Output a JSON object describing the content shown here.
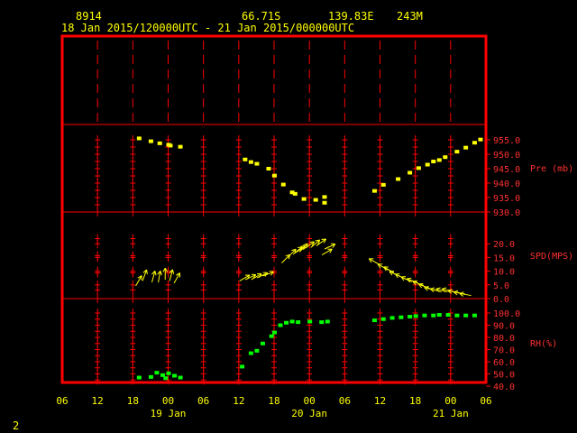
{
  "header": {
    "station_id": "8914",
    "lat": "66.71S",
    "lon": "139.83E",
    "elev": "243M",
    "period": "18 Jan 2015/120000UTC - 21 Jan 2015/000000UTC"
  },
  "footer": {
    "page_number": "2"
  },
  "colors": {
    "frame": "#ff0000",
    "pressure": "#ffff00",
    "wind": "#ffff00",
    "rh": "#00ff00",
    "axis_text": "#ffff00"
  },
  "chart_data": {
    "type": "scatter",
    "x_axis": {
      "unit": "hours since 18 Jan 2015 06UTC",
      "range": [
        0,
        72
      ],
      "tick_hours": [
        0,
        6,
        12,
        18,
        24,
        30,
        36,
        42,
        48,
        54,
        60,
        66,
        72
      ],
      "tick_labels": [
        "06",
        "12",
        "18",
        "00",
        "06",
        "12",
        "18",
        "00",
        "06",
        "12",
        "18",
        "00",
        "06"
      ],
      "day_labels": [
        {
          "hour": 18,
          "label": "19 Jan"
        },
        {
          "hour": 42,
          "label": "20 Jan"
        },
        {
          "hour": 66,
          "label": "21 Jan"
        }
      ]
    },
    "panels": [
      {
        "name": "pressure",
        "label": "Pre (mb)",
        "ylim": [
          930,
          955
        ],
        "ticks": [
          "955.0",
          "950.0",
          "945.0",
          "940.0",
          "935.0",
          "930.0"
        ],
        "tick_values": [
          955,
          950,
          945,
          940,
          935,
          930
        ],
        "points": [
          [
            13,
            955.5
          ],
          [
            15,
            954.5
          ],
          [
            16.5,
            953.8
          ],
          [
            18,
            953.3
          ],
          [
            18.3,
            953.0
          ],
          [
            20,
            952.6
          ],
          [
            31,
            948.2
          ],
          [
            32,
            947.3
          ],
          [
            33,
            946.7
          ],
          [
            35,
            945.0
          ],
          [
            36,
            942.6
          ],
          [
            37.5,
            939.5
          ],
          [
            39,
            936.8
          ],
          [
            39.5,
            936.3
          ],
          [
            41,
            934.5
          ],
          [
            43,
            934.2
          ],
          [
            44.5,
            935.2
          ],
          [
            44.5,
            933.2
          ],
          [
            53,
            937.3
          ],
          [
            54.5,
            939.4
          ],
          [
            57,
            941.4
          ],
          [
            59,
            943.6
          ],
          [
            60.5,
            945.2
          ],
          [
            62,
            946.4
          ],
          [
            63,
            947.5
          ],
          [
            64,
            948.0
          ],
          [
            65,
            949.0
          ],
          [
            67,
            950.9
          ],
          [
            68.5,
            952.3
          ],
          [
            70,
            954.0
          ],
          [
            71,
            955.1
          ]
        ]
      },
      {
        "name": "wind",
        "label": "SPD(MPS)",
        "ylim": [
          0,
          25
        ],
        "ticks": [
          "20.0",
          "15.0",
          "10.0",
          "5.0",
          "0.0"
        ],
        "tick_values": [
          20,
          15,
          10,
          5,
          0
        ],
        "arrows": [
          [
            13,
            6.5,
            30
          ],
          [
            14,
            8.5,
            20
          ],
          [
            15.5,
            8,
            15
          ],
          [
            16.5,
            8,
            10
          ],
          [
            17.5,
            9,
            0
          ],
          [
            18.5,
            8.5,
            15
          ],
          [
            19.5,
            7.5,
            30
          ],
          [
            31,
            7.5,
            60
          ],
          [
            32,
            7.8,
            65
          ],
          [
            33,
            8,
            60
          ],
          [
            34,
            8.5,
            65
          ],
          [
            35,
            9,
            70
          ],
          [
            38,
            14.5,
            45
          ],
          [
            39,
            16.5,
            45
          ],
          [
            40,
            17.5,
            50
          ],
          [
            40.5,
            18,
            55
          ],
          [
            41,
            18.5,
            45
          ],
          [
            42,
            19.5,
            55
          ],
          [
            43,
            20,
            50
          ],
          [
            44,
            20.5,
            55
          ],
          [
            45,
            17,
            60
          ],
          [
            45.5,
            19,
            65
          ],
          [
            53,
            13.5,
            -60
          ],
          [
            54.5,
            11.5,
            -60
          ],
          [
            55.5,
            10.5,
            -60
          ],
          [
            56.5,
            9,
            -65
          ],
          [
            57.5,
            8,
            -65
          ],
          [
            58.5,
            7,
            -65
          ],
          [
            59.5,
            6.5,
            -70
          ],
          [
            60.5,
            5.5,
            -70
          ],
          [
            61.5,
            4.5,
            -70
          ],
          [
            62.5,
            3.5,
            -75
          ],
          [
            63.5,
            3,
            -75
          ],
          [
            64.5,
            3,
            -75
          ],
          [
            65.5,
            3,
            -75
          ],
          [
            66.5,
            2.5,
            -80
          ],
          [
            67.5,
            2,
            -80
          ],
          [
            68.5,
            1.5,
            -80
          ]
        ]
      },
      {
        "name": "rh",
        "label": "RH(%)",
        "ylim": [
          40,
          100
        ],
        "ticks": [
          "100.0",
          "90.0",
          "80.0",
          "70.0",
          "60.0",
          "50.0",
          "40.0"
        ],
        "tick_values": [
          100,
          90,
          80,
          70,
          60,
          50,
          40
        ],
        "points": [
          [
            13,
            47
          ],
          [
            15,
            47.5
          ],
          [
            16,
            51
          ],
          [
            17,
            49
          ],
          [
            17.5,
            46.5
          ],
          [
            18,
            50.5
          ],
          [
            19,
            48.5
          ],
          [
            20,
            47
          ],
          [
            30.5,
            56
          ],
          [
            32,
            67
          ],
          [
            33,
            69
          ],
          [
            34,
            75
          ],
          [
            35.5,
            81
          ],
          [
            36,
            84
          ],
          [
            37,
            90
          ],
          [
            38,
            92
          ],
          [
            39,
            93
          ],
          [
            40,
            92.5
          ],
          [
            42,
            93
          ],
          [
            44,
            92.5
          ],
          [
            45,
            93
          ],
          [
            53,
            94
          ],
          [
            54.5,
            95
          ],
          [
            56,
            96
          ],
          [
            57.5,
            96.5
          ],
          [
            59,
            97
          ],
          [
            60,
            97.5
          ],
          [
            61.5,
            98
          ],
          [
            63,
            98
          ],
          [
            64,
            98.5
          ],
          [
            65.5,
            98.5
          ],
          [
            67,
            98
          ],
          [
            68.5,
            98
          ],
          [
            70,
            98
          ]
        ]
      }
    ]
  }
}
